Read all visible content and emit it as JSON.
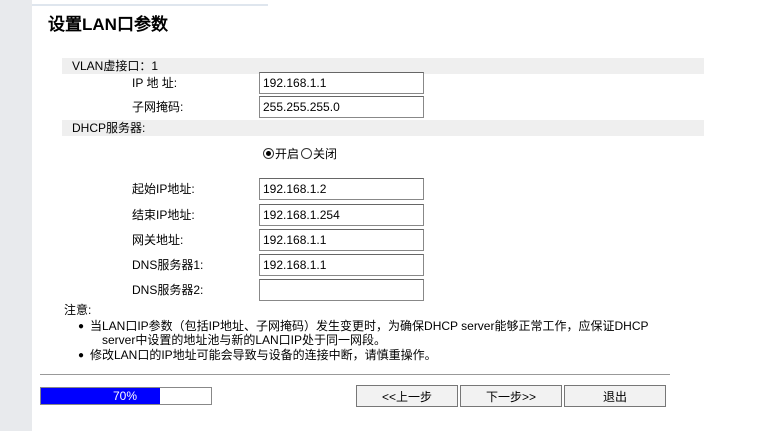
{
  "page": {
    "title": "设置LAN口参数"
  },
  "vlan": {
    "label": "VLAN虚接口：1"
  },
  "lan": {
    "ip_label": "IP 地 址:",
    "ip_value": "192.168.1.1",
    "mask_label": "子网掩码:",
    "mask_value": "255.255.255.0"
  },
  "dhcp": {
    "section_label": "DHCP服务器:",
    "enable_label": "开启",
    "disable_label": "关闭",
    "selected": "开启",
    "start_ip_label": "起始IP地址:",
    "start_ip_value": "192.168.1.2",
    "end_ip_label": "结束IP地址:",
    "end_ip_value": "192.168.1.254",
    "gateway_label": "网关地址:",
    "gateway_value": "192.168.1.1",
    "dns1_label": "DNS服务器1:",
    "dns1_value": "192.168.1.1",
    "dns2_label": "DNS服务器2:",
    "dns2_value": ""
  },
  "notes": {
    "label": "注意:",
    "items": [
      {
        "line1": "当LAN口IP参数（包括IP地址、子网掩码）发生变更时，为确保DHCP server能够正常工作，应保证DHCP",
        "line2": "server中设置的地址池与新的LAN口IP处于同一网段。"
      },
      {
        "line1": "修改LAN口的IP地址可能会导致与设备的连接中断，请慎重操作。"
      }
    ]
  },
  "progress": {
    "percent": 70,
    "label": "70%"
  },
  "buttons": {
    "prev": "<<上一步",
    "next": "下一步>>",
    "exit": "退出"
  },
  "colors": {
    "progress_fill": "#0000ff",
    "band_bg": "#efefef"
  }
}
